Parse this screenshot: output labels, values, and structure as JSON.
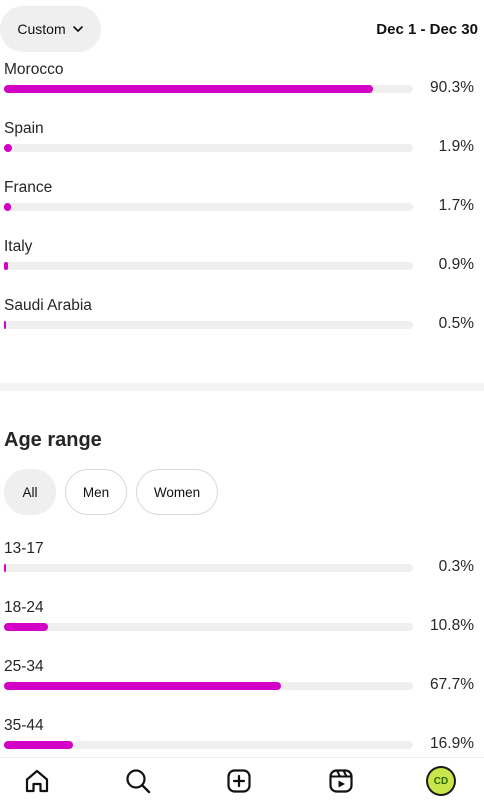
{
  "header": {
    "filter_label": "Custom",
    "date_range": "Dec 1 - Dec 30"
  },
  "countries": {
    "items": [
      {
        "label": "Morocco",
        "value": "90.3%",
        "fraction": 0.903
      },
      {
        "label": "Spain",
        "value": "1.9%",
        "fraction": 0.019
      },
      {
        "label": "France",
        "value": "1.7%",
        "fraction": 0.017
      },
      {
        "label": "Italy",
        "value": "0.9%",
        "fraction": 0.009
      },
      {
        "label": "Saudi Arabia",
        "value": "0.5%",
        "fraction": 0.005
      }
    ]
  },
  "age_range": {
    "title": "Age range",
    "filters": [
      {
        "label": "All",
        "selected": true
      },
      {
        "label": "Men",
        "selected": false
      },
      {
        "label": "Women",
        "selected": false
      }
    ],
    "items": [
      {
        "label": "13-17",
        "value": "0.3%",
        "fraction": 0.003
      },
      {
        "label": "18-24",
        "value": "10.8%",
        "fraction": 0.108
      },
      {
        "label": "25-34",
        "value": "67.7%",
        "fraction": 0.677
      },
      {
        "label": "35-44",
        "value": "16.9%",
        "fraction": 0.169
      }
    ]
  },
  "colors": {
    "bar_fill": "#d300c5",
    "bar_track": "#efefef"
  },
  "bottom_nav": {
    "items": [
      "home-icon",
      "search-icon",
      "create-icon",
      "reels-icon",
      "profile-avatar"
    ],
    "avatar_text": "CD"
  }
}
